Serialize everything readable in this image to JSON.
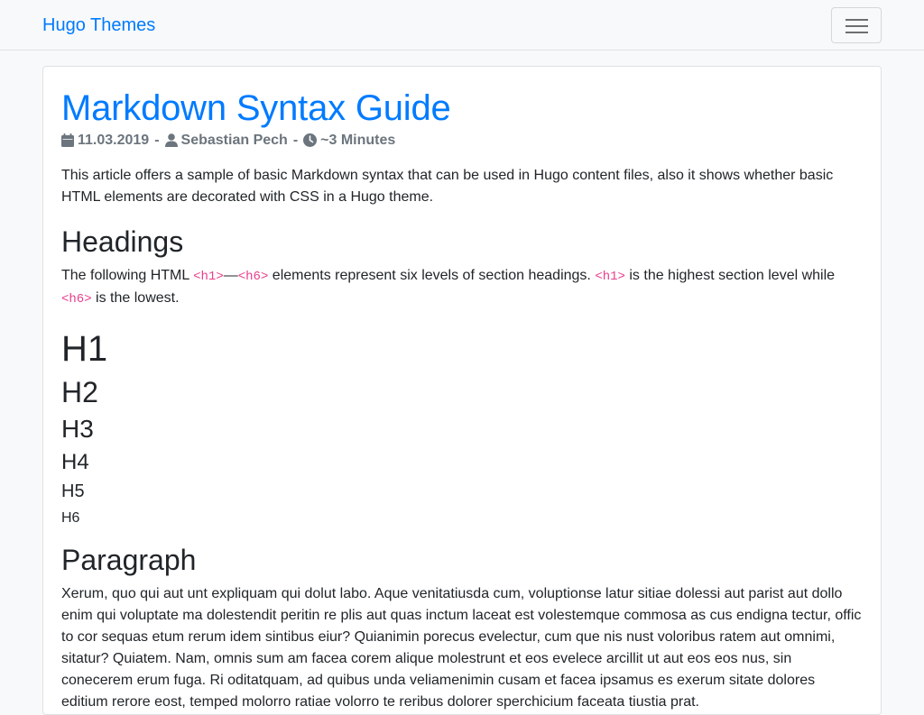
{
  "navbar": {
    "brand": "Hugo Themes",
    "toggler_icon": "hamburger-menu-icon"
  },
  "article": {
    "title": "Markdown Syntax Guide",
    "meta": {
      "calendar_icon": "calendar-icon",
      "date": "11.03.2019",
      "separator": "-",
      "user_icon": "user-icon",
      "author": "Sebastian Pech",
      "clock_icon": "clock-icon",
      "reading_time": "~3 Minutes"
    },
    "intro": "This article offers a sample of basic Markdown syntax that can be used in Hugo content files, also it shows whether basic HTML elements are decorated with CSS in a Hugo theme.",
    "headings_section": {
      "title": "Headings",
      "text_1": "The following HTML ",
      "code_1": "<h1>",
      "dash": "—",
      "code_2": "<h6>",
      "text_2": " elements represent six levels of section headings. ",
      "code_3": "<h1>",
      "text_3": " is the highest section level while ",
      "code_4": "<h6>",
      "text_4": " is the lowest."
    },
    "heading_samples": [
      "H1",
      "H2",
      "H3",
      "H4",
      "H5",
      "H6"
    ],
    "paragraph_section": {
      "title": "Paragraph",
      "text": "Xerum, quo qui aut unt expliquam qui dolut labo. Aque venitatiusda cum, voluptionse latur sitiae dolessi aut parist aut dollo enim qui voluptate ma dolestendit peritin re plis aut quas inctum laceat est volestemque commosa as cus endigna tectur, offic to cor sequas etum rerum idem sintibus eiur? Quianimin porecus evelectur, cum que nis nust voloribus ratem aut omnimi, sitatur? Quiatem. Nam, omnis sum am facea corem alique molestrunt et eos evelece arcillit ut aut eos eos nus, sin conecerem erum fuga. Ri oditatquam, ad quibus unda veliamenimin cusam et facea ipsamus es exerum sitate dolores editium rerore eost, temped molorro ratiae volorro te reribus dolorer sperchicium faceata tiustia prat."
    }
  }
}
